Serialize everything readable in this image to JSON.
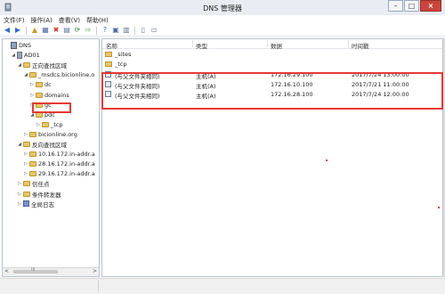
{
  "window": {
    "title": "DNS 管理器"
  },
  "window_buttons": {
    "minimize": "–",
    "maximize": "□",
    "close": "×"
  },
  "menu": [
    "文件(F)",
    "操作(A)",
    "查看(V)",
    "帮助(H)"
  ],
  "toolbar": [
    {
      "name": "back-icon",
      "glyph": "◀",
      "color": "#2f6ec5"
    },
    {
      "name": "forward-icon",
      "glyph": "▶",
      "color": "#2f6ec5"
    },
    {
      "name": "up-folder-icon",
      "glyph": "▲",
      "color": "#c59a2a"
    },
    {
      "name": "show-tree-icon",
      "glyph": "▦",
      "color": "#4c6aa0"
    },
    {
      "name": "delete-icon",
      "glyph": "✖",
      "color": "#d23b2f"
    },
    {
      "name": "properties-icon",
      "glyph": "▤",
      "color": "#5f7295"
    },
    {
      "name": "refresh-icon",
      "glyph": "⟳",
      "color": "#3a8d46"
    },
    {
      "name": "export-icon",
      "glyph": "⇨",
      "color": "#3a8d46"
    },
    {
      "name": "help-icon",
      "glyph": "?",
      "color": "#2f6ec5"
    },
    {
      "name": "view-icon",
      "glyph": "▣",
      "color": "#4c6aa0"
    },
    {
      "name": "server-list-icon",
      "glyph": "▥",
      "color": "#5f7295"
    },
    {
      "name": "record-icon",
      "glyph": "▯",
      "color": "#5f7295"
    },
    {
      "name": "zone-icon",
      "glyph": "▭",
      "color": "#5f7295"
    }
  ],
  "tree": [
    {
      "label": "DNS",
      "level": 0,
      "exp": "",
      "icon": "dns"
    },
    {
      "label": "AD01",
      "level": 1,
      "exp": "◢",
      "icon": "server"
    },
    {
      "label": "正向查找区域",
      "level": 2,
      "exp": "◢",
      "icon": "folder"
    },
    {
      "label": "_msdcs.bicionline.o",
      "level": 3,
      "exp": "◢",
      "icon": "folder"
    },
    {
      "label": "dc",
      "level": 4,
      "exp": "▷",
      "icon": "folder"
    },
    {
      "label": "domains",
      "level": 4,
      "exp": "▷",
      "icon": "folder"
    },
    {
      "label": "gc",
      "level": 4,
      "exp": "▷",
      "icon": "folder"
    },
    {
      "label": "pdc",
      "level": 4,
      "exp": "◢",
      "icon": "folder"
    },
    {
      "label": "_tcp",
      "level": 5,
      "exp": "▷",
      "icon": "folder"
    },
    {
      "label": "bicionline.org",
      "level": 3,
      "exp": "▷",
      "icon": "folder"
    },
    {
      "label": "反向查找区域",
      "level": 2,
      "exp": "◢",
      "icon": "folder"
    },
    {
      "label": "10.16.172.in-addr.a",
      "level": 3,
      "exp": "▷",
      "icon": "folder"
    },
    {
      "label": "28.16.172.in-addr.a",
      "level": 3,
      "exp": "▷",
      "icon": "folder"
    },
    {
      "label": "29.16.172.in-addr.a",
      "level": 3,
      "exp": "▷",
      "icon": "folder"
    },
    {
      "label": "信任点",
      "level": 2,
      "exp": "▷",
      "icon": "folder"
    },
    {
      "label": "条件转发器",
      "level": 2,
      "exp": "▷",
      "icon": "folder"
    },
    {
      "label": "全局日志",
      "level": 2,
      "exp": "▷",
      "icon": "book"
    }
  ],
  "list": {
    "headers": [
      "名称",
      "类型",
      "数据",
      "时间戳"
    ],
    "rows": [
      {
        "kind": "folder",
        "name": "_sites",
        "type": "",
        "data": "",
        "timestamp": ""
      },
      {
        "kind": "folder",
        "name": "_tcp",
        "type": "",
        "data": "",
        "timestamp": ""
      },
      {
        "kind": "record",
        "name": "(与父文件夹相同)",
        "type": "主机(A)",
        "data": "172.16.29.100",
        "timestamp": "2017/7/24 13:00:00"
      },
      {
        "kind": "record",
        "name": "(与父文件夹相同)",
        "type": "主机(A)",
        "data": "172.16.10.100",
        "timestamp": "2017/7/21 11:00:00"
      },
      {
        "kind": "record",
        "name": "(与父文件夹相同)",
        "type": "主机(A)",
        "data": "172.16.28.100",
        "timestamp": "2017/7/24 12:00:00"
      }
    ]
  },
  "scroll": {
    "left": "<",
    "right": ">",
    "grip": "III"
  },
  "colors": {
    "highlight": "#e53935",
    "folder": "#e8c766",
    "accent": "#2f6ec5"
  }
}
